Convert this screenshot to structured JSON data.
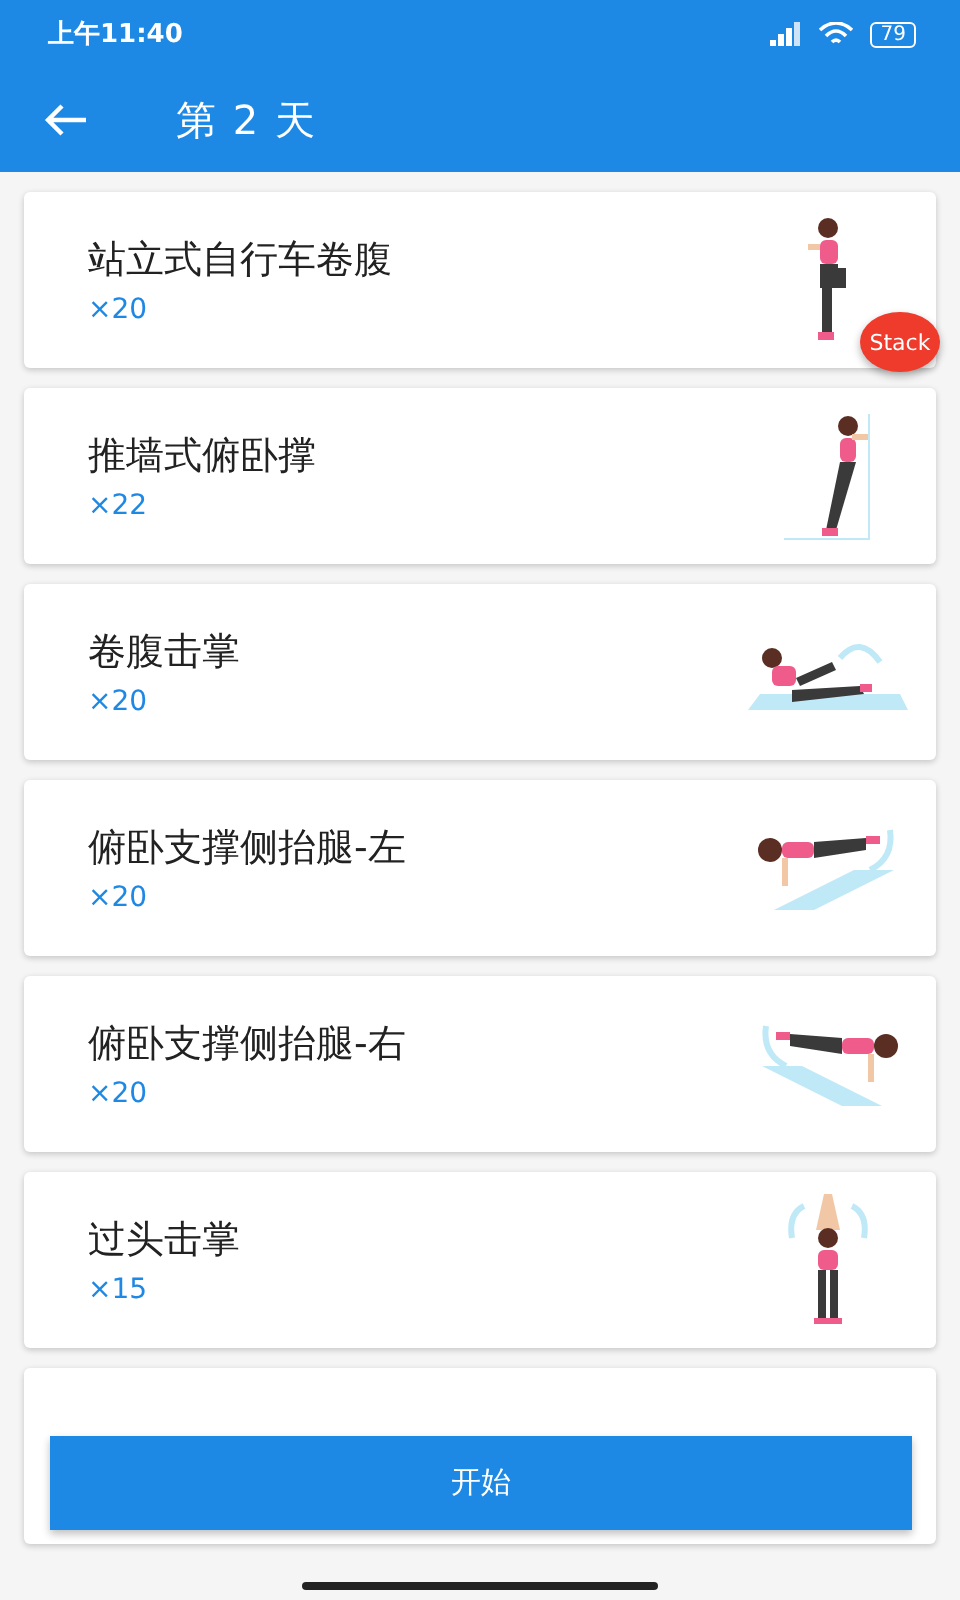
{
  "status_bar": {
    "time": "上午11:40",
    "battery": "79"
  },
  "app_bar": {
    "title": "第 2 天"
  },
  "exercises": [
    {
      "name": "站立式自行车卷腹",
      "reps": "×20",
      "kind": "knee"
    },
    {
      "name": "推墙式俯卧撑",
      "reps": "×22",
      "kind": "wall"
    },
    {
      "name": "卷腹击掌",
      "reps": "×20",
      "kind": "crunch"
    },
    {
      "name": "俯卧支撑侧抬腿-左",
      "reps": "×20",
      "kind": "plankleft"
    },
    {
      "name": "俯卧支撑侧抬腿-右",
      "reps": "×20",
      "kind": "plankright"
    },
    {
      "name": "过头击掌",
      "reps": "×15",
      "kind": "overhead"
    }
  ],
  "floating_badge": {
    "label": "Stack"
  },
  "start_button": {
    "label": "开始"
  }
}
